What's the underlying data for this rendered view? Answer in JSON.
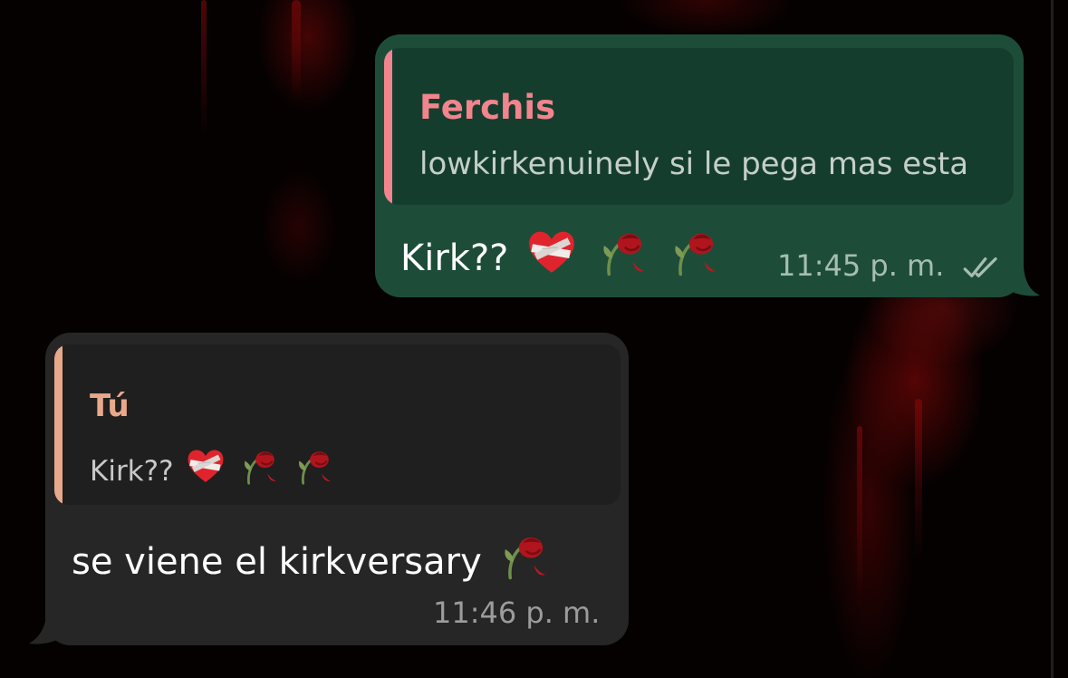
{
  "messages": [
    {
      "direction": "outgoing",
      "reply_to": {
        "author": "Ferchis",
        "author_color": "#f2848d",
        "text": "lowkirkenuinely si le pega mas esta"
      },
      "text": "Kirk??",
      "emojis": [
        "mending-heart-icon",
        "wilted-flower-icon",
        "wilted-flower-icon"
      ],
      "time": "11:45 p. m.",
      "status": "read-double-check-icon"
    },
    {
      "direction": "incoming",
      "reply_to": {
        "author": "Tú",
        "author_color": "#e8a98b",
        "text": "Kirk??"
      },
      "reply_emojis": [
        "mending-heart-icon",
        "wilted-flower-icon",
        "wilted-flower-icon"
      ],
      "text": "se viene el kirkversary",
      "emojis": [
        "wilted-flower-icon"
      ],
      "time": "11:46 p. m."
    }
  ],
  "colors": {
    "outgoing_bubble": "#1d4d39",
    "outgoing_quote": "#153d2d",
    "incoming_bubble": "#262626",
    "incoming_quote": "#1f1f1f"
  }
}
